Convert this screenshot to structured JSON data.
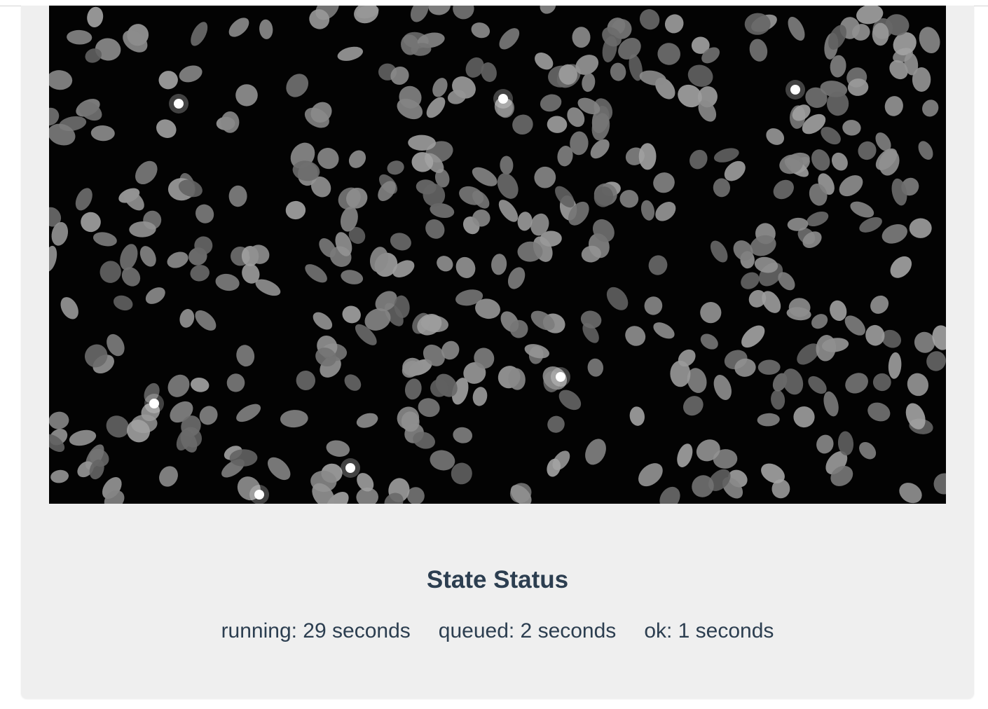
{
  "image": {
    "alt_subject": "fluorescence-micrograph-nuclei",
    "background_color": "#030303",
    "nucleus_color": "#8a8a8a"
  },
  "state_status": {
    "title": "State Status",
    "items": [
      {
        "label": "running: 29 seconds"
      },
      {
        "label": "queued: 2 seconds"
      },
      {
        "label": "ok: 1 seconds"
      }
    ]
  }
}
